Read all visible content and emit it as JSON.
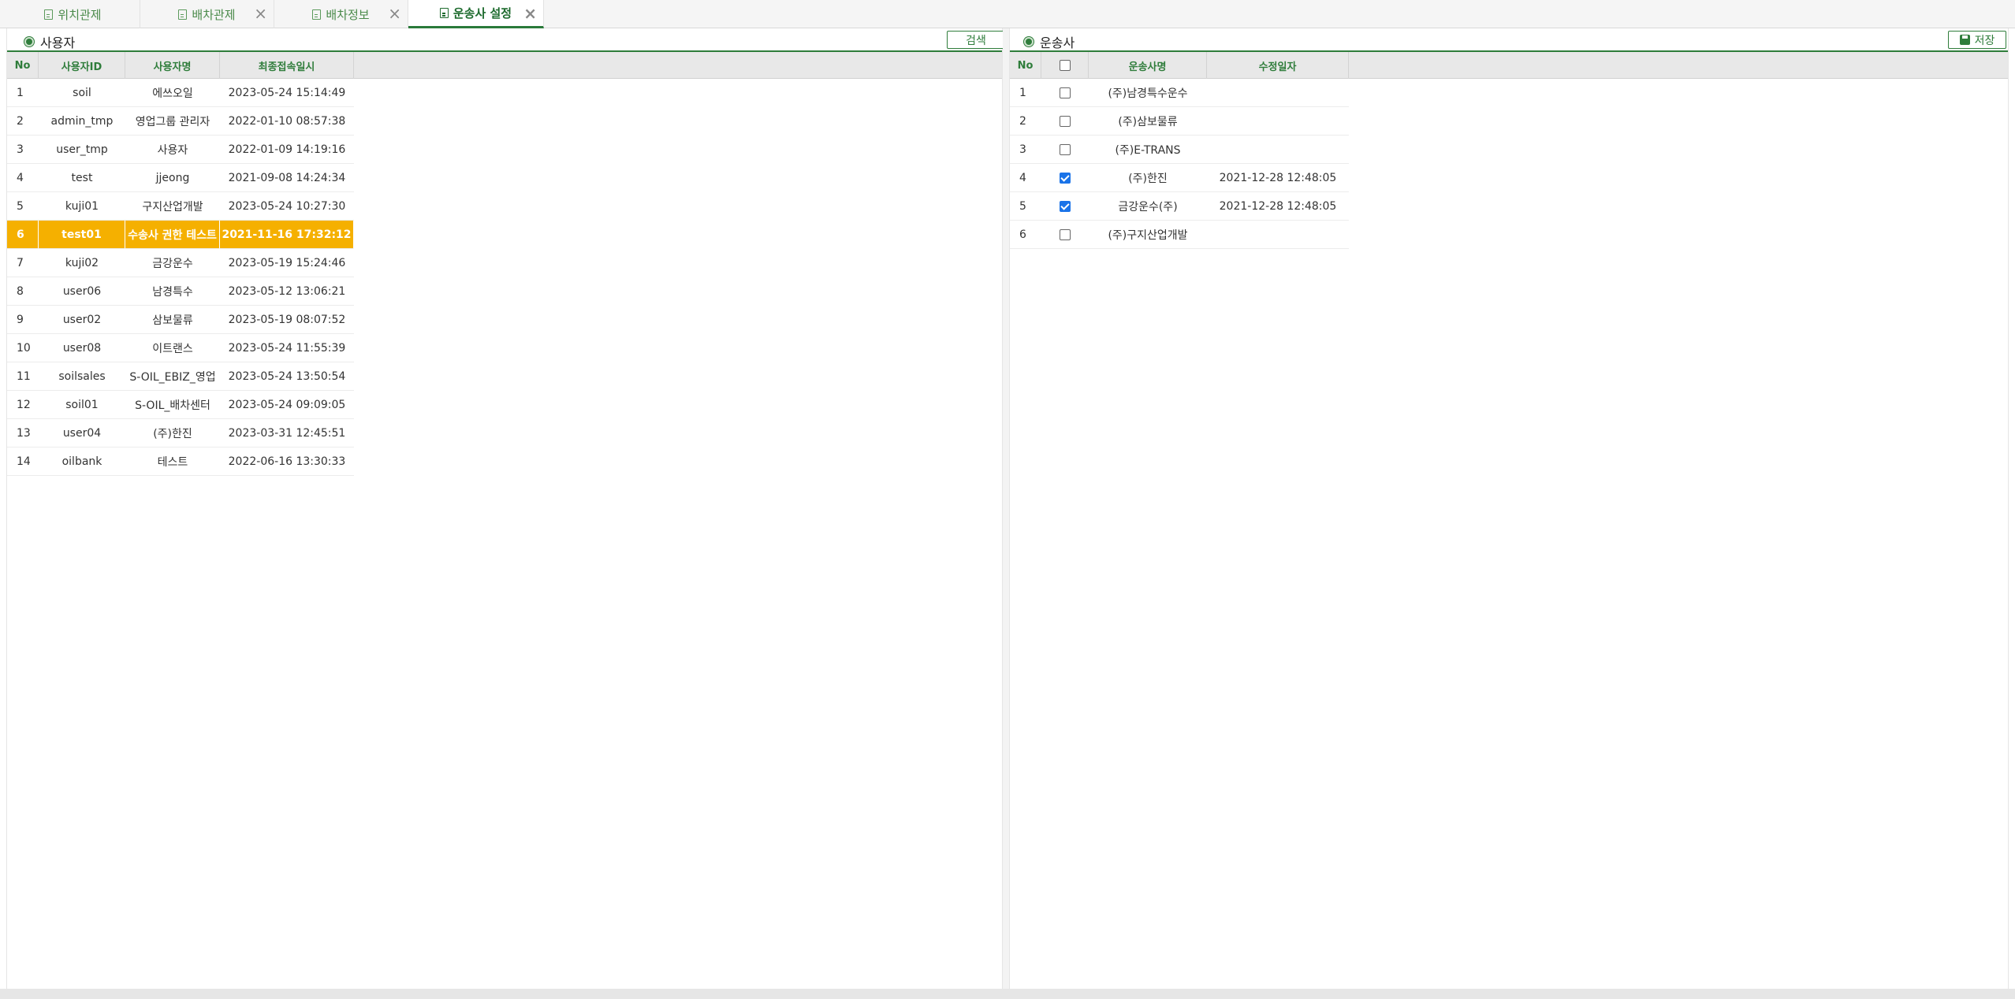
{
  "tabs": [
    {
      "label": "위치관제",
      "closable": false
    },
    {
      "label": "배차관제",
      "closable": true
    },
    {
      "label": "배차정보",
      "closable": true
    },
    {
      "label": "운송사 설정",
      "closable": true,
      "active": true
    }
  ],
  "left_panel": {
    "title": "사용자",
    "search_button": "검색",
    "columns": [
      "No",
      "사용자ID",
      "사용자명",
      "최종접속일시"
    ],
    "selected_row": 6,
    "rows": [
      {
        "no": "1",
        "id": "soil",
        "name": "에쓰오일",
        "last": "2023-05-24 15:14:49"
      },
      {
        "no": "2",
        "id": "admin_tmp",
        "name": "영업그룹 관리자",
        "last": "2022-01-10 08:57:38"
      },
      {
        "no": "3",
        "id": "user_tmp",
        "name": "사용자",
        "last": "2022-01-09 14:19:16"
      },
      {
        "no": "4",
        "id": "test",
        "name": "jjeong",
        "last": "2021-09-08 14:24:34"
      },
      {
        "no": "5",
        "id": "kuji01",
        "name": "구지산업개발",
        "last": "2023-05-24 10:27:30"
      },
      {
        "no": "6",
        "id": "test01",
        "name": "수송사 권한 테스트",
        "last": "2021-11-16 17:32:12"
      },
      {
        "no": "7",
        "id": "kuji02",
        "name": "금강운수",
        "last": "2023-05-19 15:24:46"
      },
      {
        "no": "8",
        "id": "user06",
        "name": "남경특수",
        "last": "2023-05-12 13:06:21"
      },
      {
        "no": "9",
        "id": "user02",
        "name": "삼보물류",
        "last": "2023-05-19 08:07:52"
      },
      {
        "no": "10",
        "id": "user08",
        "name": "이트랜스",
        "last": "2023-05-24 11:55:39"
      },
      {
        "no": "11",
        "id": "soilsales",
        "name": "S-OIL_EBIZ_영업",
        "last": "2023-05-24 13:50:54"
      },
      {
        "no": "12",
        "id": "soil01",
        "name": "S-OIL_배차센터",
        "last": "2023-05-24 09:09:05"
      },
      {
        "no": "13",
        "id": "user04",
        "name": "(주)한진",
        "last": "2023-03-31 12:45:51"
      },
      {
        "no": "14",
        "id": "oilbank",
        "name": "테스트",
        "last": "2022-06-16 13:30:33"
      }
    ]
  },
  "right_panel": {
    "title": "운송사",
    "save_button": "저장",
    "columns": [
      "No",
      "",
      "운송사명",
      "수정일자"
    ],
    "rows": [
      {
        "no": "1",
        "checked": false,
        "name": "(주)남경특수운수",
        "modified": ""
      },
      {
        "no": "2",
        "checked": false,
        "name": "(주)삼보물류",
        "modified": ""
      },
      {
        "no": "3",
        "checked": false,
        "name": "(주)E-TRANS",
        "modified": ""
      },
      {
        "no": "4",
        "checked": true,
        "name": "(주)한진",
        "modified": "2021-12-28 12:48:05"
      },
      {
        "no": "5",
        "checked": true,
        "name": "금강운수(주)",
        "modified": "2021-12-28 12:48:05"
      },
      {
        "no": "6",
        "checked": false,
        "name": "(주)구지산업개발",
        "modified": ""
      }
    ]
  },
  "colors": {
    "accent": "#2f7d3b",
    "selected_row": "#f5b000",
    "checkbox_on": "#1a73e8"
  }
}
